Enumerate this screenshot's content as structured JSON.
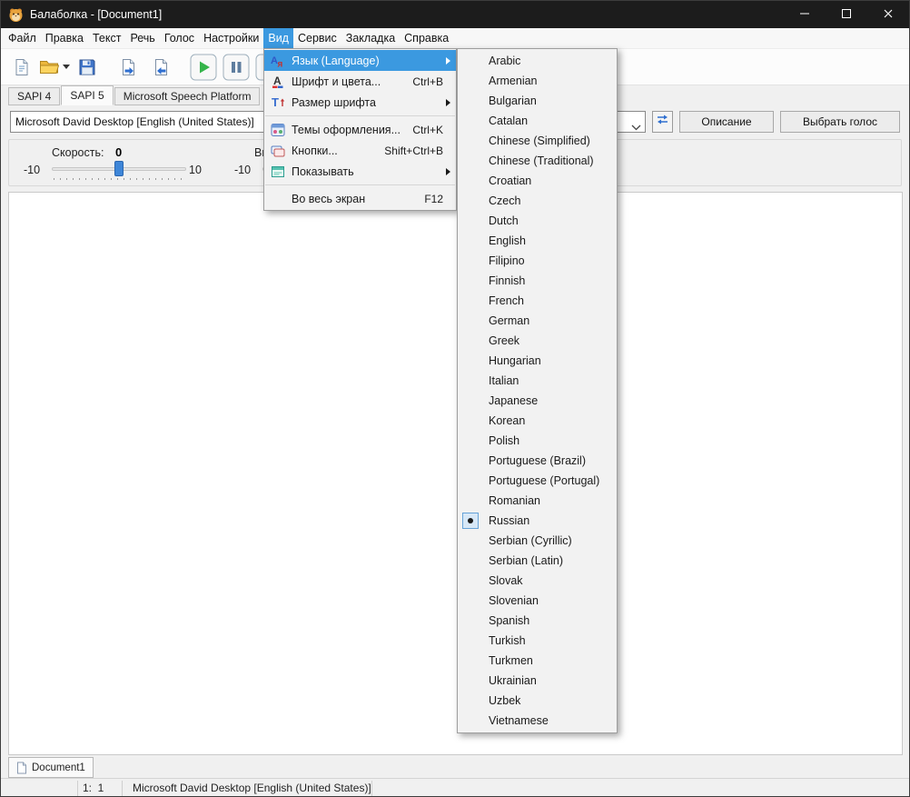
{
  "window": {
    "title": "Балаболка - [Document1]",
    "icon": "app-hamster-icon"
  },
  "menubar": {
    "active": "Вид",
    "items": [
      "Файл",
      "Правка",
      "Текст",
      "Речь",
      "Голос",
      "Настройки",
      "Вид",
      "Сервис",
      "Закладка",
      "Справка"
    ]
  },
  "toolbar": {
    "buttons": [
      {
        "name": "new-document-button",
        "icon": "new-document-icon"
      },
      {
        "name": "open-file-button",
        "icon": "open-folder-icon",
        "dropdown": true
      },
      {
        "name": "save-button",
        "icon": "save-icon"
      },
      {
        "name": "open-text-button",
        "icon": "import-text-icon"
      },
      {
        "name": "append-text-button",
        "icon": "export-text-icon"
      },
      {
        "name": "play-button",
        "icon": "play-icon"
      },
      {
        "name": "pause-button",
        "icon": "pause-icon"
      },
      {
        "name": "stop-button",
        "icon": "stop-icon"
      }
    ]
  },
  "engine_tabs": [
    {
      "label": "SAPI 4",
      "active": false
    },
    {
      "label": "SAPI 5",
      "active": true
    },
    {
      "label": "Microsoft Speech Platform",
      "active": false
    }
  ],
  "voice_row": {
    "selected_voice": "Microsoft David Desktop [English (United States)]",
    "combo_arrow_icon": "combo-chevron-icon",
    "refresh_button_icon": "refresh-icon",
    "description_button": "Описание",
    "select_voice_button": "Выбрать голос"
  },
  "sliders": {
    "speed_label": "Скорость:",
    "speed_value": "0",
    "speed_min": "-10",
    "speed_max": "10",
    "pitch_label_visible": "Вы",
    "pitch_min": "-10"
  },
  "view_menu": {
    "items": [
      {
        "label": "Язык (Language)",
        "icon": "language-icon",
        "submenu": true,
        "highlighted": true
      },
      {
        "label": "Шрифт и цвета...",
        "icon": "font-colors-icon",
        "shortcut": "Ctrl+B"
      },
      {
        "label": "Размер шрифта",
        "icon": "font-size-icon",
        "submenu": true
      },
      {
        "separator": true
      },
      {
        "label": "Темы оформления...",
        "icon": "themes-icon",
        "shortcut": "Ctrl+K"
      },
      {
        "label": "Кнопки...",
        "icon": "buttons-icon",
        "shortcut": "Shift+Ctrl+B"
      },
      {
        "label": "Показывать",
        "icon": "show-icon",
        "submenu": true
      },
      {
        "separator": true
      },
      {
        "label": "Во весь экран",
        "shortcut": "F12"
      }
    ]
  },
  "language_submenu": {
    "selected": "Russian",
    "items": [
      "Arabic",
      "Armenian",
      "Bulgarian",
      "Catalan",
      "Chinese (Simplified)",
      "Chinese (Traditional)",
      "Croatian",
      "Czech",
      "Dutch",
      "English",
      "Filipino",
      "Finnish",
      "French",
      "German",
      "Greek",
      "Hungarian",
      "Italian",
      "Japanese",
      "Korean",
      "Polish",
      "Portuguese (Brazil)",
      "Portuguese (Portugal)",
      "Romanian",
      "Russian",
      "Serbian (Cyrillic)",
      "Serbian (Latin)",
      "Slovak",
      "Slovenian",
      "Spanish",
      "Turkish",
      "Turkmen",
      "Ukrainian",
      "Uzbek",
      "Vietnamese"
    ]
  },
  "document_tabs": [
    {
      "label": "Document1",
      "icon": "doc-page-icon",
      "active": true
    }
  ],
  "statusbar": {
    "position": "1:  1",
    "voice": "Microsoft David Desktop [English (United States)]"
  },
  "colors": {
    "menu_highlight": "#3b99e0",
    "titlebar": "#1c1c1c"
  }
}
